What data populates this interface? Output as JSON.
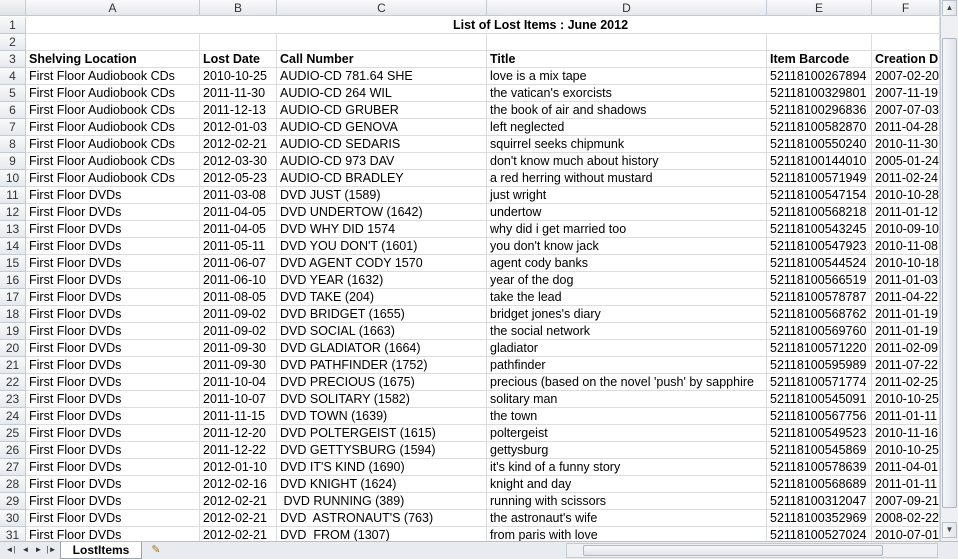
{
  "columns": [
    "A",
    "B",
    "C",
    "D",
    "E",
    "F"
  ],
  "title_row": {
    "num": "1",
    "text": "List of Lost Items : June 2012"
  },
  "empty_row": {
    "num": "2"
  },
  "header_row": {
    "num": "3",
    "cells": [
      "Shelving Location",
      "Lost Date",
      "Call Number",
      "Title",
      "Item Barcode",
      "Creation D"
    ]
  },
  "rows": [
    {
      "num": "4",
      "cells": [
        "First Floor Audiobook CDs",
        "2010-10-25",
        "AUDIO-CD 781.64 SHE",
        "love is a mix tape",
        "52118100267894",
        "2007-02-20"
      ]
    },
    {
      "num": "5",
      "cells": [
        "First Floor Audiobook CDs",
        "2011-11-30",
        "AUDIO-CD 264 WIL",
        "the vatican's exorcists",
        "52118100329801",
        "2007-11-19"
      ]
    },
    {
      "num": "6",
      "cells": [
        "First Floor Audiobook CDs",
        "2011-12-13",
        "AUDIO-CD GRUBER",
        "the book of air and shadows",
        "52118100296836",
        "2007-07-03"
      ]
    },
    {
      "num": "7",
      "cells": [
        "First Floor Audiobook CDs",
        "2012-01-03",
        "AUDIO-CD GENOVA",
        "left neglected",
        "52118100582870",
        "2011-04-28"
      ]
    },
    {
      "num": "8",
      "cells": [
        "First Floor Audiobook CDs",
        "2012-02-21",
        "AUDIO-CD SEDARIS",
        "squirrel seeks chipmunk",
        "52118100550240",
        "2010-11-30"
      ]
    },
    {
      "num": "9",
      "cells": [
        "First Floor Audiobook CDs",
        "2012-03-30",
        "AUDIO-CD 973 DAV",
        "don't know much about history",
        "52118100144010",
        "2005-01-24"
      ]
    },
    {
      "num": "10",
      "cells": [
        "First Floor Audiobook CDs",
        "2012-05-23",
        "AUDIO-CD BRADLEY",
        "a red herring without mustard",
        "52118100571949",
        "2011-02-24"
      ]
    },
    {
      "num": "11",
      "cells": [
        "First Floor DVDs",
        "2011-03-08",
        "DVD JUST (1589)",
        "just wright",
        "52118100547154",
        "2010-10-28"
      ]
    },
    {
      "num": "12",
      "cells": [
        "First Floor DVDs",
        "2011-04-05",
        "DVD UNDERTOW (1642)",
        "undertow",
        "52118100568218",
        "2011-01-12"
      ]
    },
    {
      "num": "13",
      "cells": [
        "First Floor DVDs",
        "2011-04-05",
        "DVD WHY DID 1574",
        "why did i get married too",
        "52118100543245",
        "2010-09-10"
      ]
    },
    {
      "num": "14",
      "cells": [
        "First Floor DVDs",
        "2011-05-11",
        "DVD YOU DON'T (1601)",
        "you don't know jack",
        "52118100547923",
        "2010-11-08"
      ]
    },
    {
      "num": "15",
      "cells": [
        "First Floor DVDs",
        "2011-06-07",
        "DVD AGENT CODY 1570",
        "agent cody banks",
        "52118100544524",
        "2010-10-18"
      ]
    },
    {
      "num": "16",
      "cells": [
        "First Floor DVDs",
        "2011-06-10",
        "DVD YEAR (1632)",
        "year of the dog",
        "52118100566519",
        "2011-01-03"
      ]
    },
    {
      "num": "17",
      "cells": [
        "First Floor DVDs",
        "2011-08-05",
        "DVD TAKE (204)",
        "take the lead",
        "52118100578787",
        "2011-04-22"
      ]
    },
    {
      "num": "18",
      "cells": [
        "First Floor DVDs",
        "2011-09-02",
        "DVD BRIDGET (1655)",
        "bridget jones's diary",
        "52118100568762",
        "2011-01-19"
      ]
    },
    {
      "num": "19",
      "cells": [
        "First Floor DVDs",
        "2011-09-02",
        "DVD SOCIAL (1663)",
        "the social network",
        "52118100569760",
        "2011-01-19"
      ]
    },
    {
      "num": "20",
      "cells": [
        "First Floor DVDs",
        "2011-09-30",
        "DVD GLADIATOR (1664)",
        "gladiator",
        "52118100571220",
        "2011-02-09"
      ]
    },
    {
      "num": "21",
      "cells": [
        "First Floor DVDs",
        "2011-09-30",
        "DVD PATHFINDER (1752)",
        "pathfinder",
        "52118100595989",
        "2011-07-22"
      ]
    },
    {
      "num": "22",
      "cells": [
        "First Floor DVDs",
        "2011-10-04",
        "DVD PRECIOUS (1675)",
        "precious (based on the novel 'push' by sapphire",
        "52118100571774",
        "2011-02-25"
      ]
    },
    {
      "num": "23",
      "cells": [
        "First Floor DVDs",
        "2011-10-07",
        "DVD SOLITARY (1582)",
        "solitary man",
        "52118100545091",
        "2010-10-25"
      ]
    },
    {
      "num": "24",
      "cells": [
        "First Floor DVDs",
        "2011-11-15",
        "DVD TOWN (1639)",
        "the town",
        "52118100567756",
        "2011-01-11"
      ]
    },
    {
      "num": "25",
      "cells": [
        "First Floor DVDs",
        "2011-12-20",
        "DVD POLTERGEIST (1615)",
        "poltergeist",
        "52118100549523",
        "2010-11-16"
      ]
    },
    {
      "num": "26",
      "cells": [
        "First Floor DVDs",
        "2011-12-22",
        "DVD GETTYSBURG (1594)",
        "gettysburg",
        "52118100545869",
        "2010-10-25"
      ]
    },
    {
      "num": "27",
      "cells": [
        "First Floor DVDs",
        "2012-01-10",
        "DVD IT'S KIND (1690)",
        "it's kind of a funny story",
        "52118100578639",
        "2011-04-01"
      ]
    },
    {
      "num": "28",
      "cells": [
        "First Floor DVDs",
        "2012-02-16",
        "DVD KNIGHT (1624)",
        "knight and day",
        "52118100568689",
        "2011-01-11"
      ]
    },
    {
      "num": "29",
      "cells": [
        "First Floor DVDs",
        "2012-02-21",
        " DVD RUNNING (389)",
        "running with scissors",
        "52118100312047",
        "2007-09-21"
      ]
    },
    {
      "num": "30",
      "cells": [
        "First Floor DVDs",
        "2012-02-21",
        "DVD  ASTRONAUT'S (763)",
        "the astronaut's wife",
        "52118100352969",
        "2008-02-22"
      ]
    },
    {
      "num": "31",
      "cells": [
        "First Floor DVDs",
        "2012-02-21",
        "DVD  FROM (1307)",
        "from paris with love",
        "52118100527024",
        "2010-07-01"
      ]
    }
  ],
  "sheet_tab": {
    "label": "LostItems"
  },
  "icons": {
    "nav_first": "◄|",
    "nav_prev": "◄",
    "nav_next": "►",
    "nav_last": "|►",
    "new_sheet": "✎",
    "scroll_up": "▲",
    "scroll_down": "▼"
  }
}
